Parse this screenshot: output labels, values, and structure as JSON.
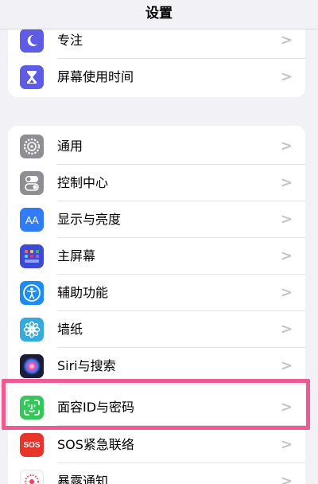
{
  "header": {
    "title": "设置"
  },
  "group_top": {
    "items": [
      {
        "label": "专注",
        "icon": "moon-icon",
        "color": "#5e5ce6"
      },
      {
        "label": "屏幕使用时间",
        "icon": "hourglass-icon",
        "color": "#5e5ce6"
      }
    ]
  },
  "group_main": {
    "items": [
      {
        "label": "通用",
        "icon": "gear-icon",
        "color": "#8e8e93"
      },
      {
        "label": "控制中心",
        "icon": "toggles-icon",
        "color": "#8e8e93"
      },
      {
        "label": "显示与亮度",
        "icon": "text-size-icon",
        "icon_text": "AA",
        "color": "#2f7cf6"
      },
      {
        "label": "主屏幕",
        "icon": "app-grid-icon",
        "color": "#3b4bd8"
      },
      {
        "label": "辅助功能",
        "icon": "accessibility-icon",
        "color": "#1a8cf5"
      },
      {
        "label": "墙纸",
        "icon": "flower-icon",
        "color": "#35aadc"
      },
      {
        "label": "Siri与搜索",
        "icon": "siri-icon",
        "color": "#1c1c3a"
      },
      {
        "label": "面容ID与密码",
        "icon": "face-id-icon",
        "color": "#34c759"
      },
      {
        "label": "SOS紧急联络",
        "icon": "sos-icon",
        "icon_text": "SOS",
        "color": "#e8352c"
      },
      {
        "label": "暴露通知",
        "icon": "exposure-icon",
        "color": "#ffffff"
      }
    ]
  },
  "chevron": ">"
}
